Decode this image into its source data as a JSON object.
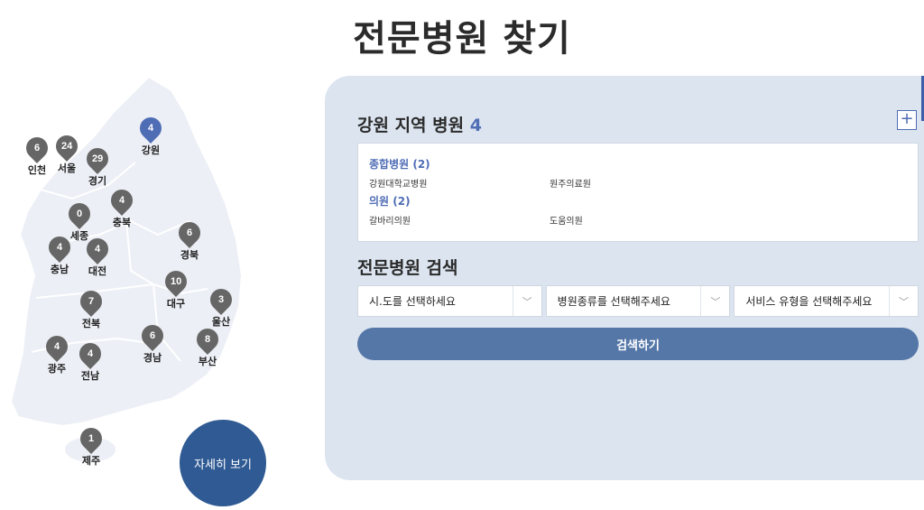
{
  "page": {
    "title": "전문병원 찾기"
  },
  "map": {
    "pins": [
      {
        "count": "6",
        "label": "인천"
      },
      {
        "count": "24",
        "label": "서울"
      },
      {
        "count": "29",
        "label": "경기"
      },
      {
        "count": "4",
        "label": "강원"
      },
      {
        "count": "4",
        "label": "충북"
      },
      {
        "count": "0",
        "label": "세종"
      },
      {
        "count": "4",
        "label": "충남"
      },
      {
        "count": "4",
        "label": "대전"
      },
      {
        "count": "6",
        "label": "경북"
      },
      {
        "count": "10",
        "label": "대구"
      },
      {
        "count": "3",
        "label": "울산"
      },
      {
        "count": "7",
        "label": "전북"
      },
      {
        "count": "4",
        "label": "광주"
      },
      {
        "count": "4",
        "label": "전남"
      },
      {
        "count": "6",
        "label": "경남"
      },
      {
        "count": "8",
        "label": "부산"
      },
      {
        "count": "1",
        "label": "제주"
      }
    ],
    "active_region": "강원",
    "detail_button": "자세히 보기"
  },
  "region": {
    "title": "강원 지역 병원",
    "count": "4",
    "plus": "+",
    "categories": [
      {
        "title": "종합병원 (2)",
        "items": [
          "강원대학교병원",
          "원주의료원"
        ]
      },
      {
        "title": "의원 (2)",
        "items": [
          "갈바리의원",
          "도움의원"
        ]
      }
    ]
  },
  "search": {
    "title": "전문병원 검색",
    "selects": [
      "시.도를 선택하세요",
      "병원종류를 선택해주세요",
      "서비스 유형을 선택해주세요"
    ],
    "button": "검색하기"
  },
  "icons": {
    "chevron": "chevron-down-icon",
    "plus": "plus-icon"
  },
  "colors": {
    "accent": "#4f6db5",
    "panel_bg": "#dbe4ef",
    "button": "#5577a8",
    "detail_button": "#2f5a93",
    "pin": "#666666"
  }
}
